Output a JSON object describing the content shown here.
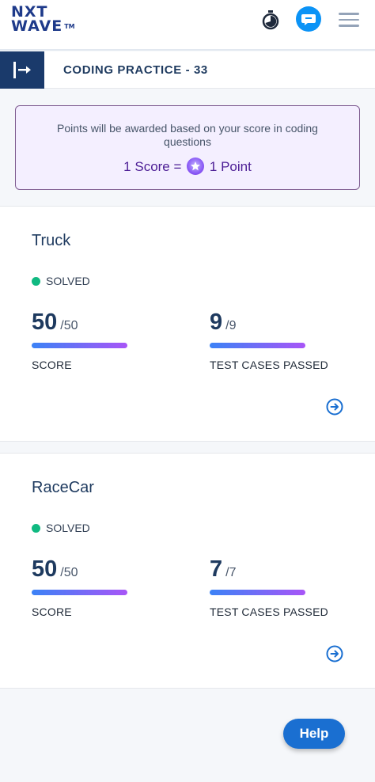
{
  "header": {
    "logo_line1": "NXT",
    "logo_line2": "WAVE",
    "logo_tm": "TM"
  },
  "subheader": {
    "title": "CODING PRACTICE - 33"
  },
  "notice": {
    "message": "Points will be awarded based on your score in coding questions",
    "rule_left": "1 Score =",
    "rule_right": "1 Point"
  },
  "problems": [
    {
      "name": "Truck",
      "status": "SOLVED",
      "score": "50",
      "score_total": "/50",
      "score_label": "SCORE",
      "tests": "9",
      "tests_total": "/9",
      "tests_label": "TEST CASES PASSED"
    },
    {
      "name": "RaceCar",
      "status": "SOLVED",
      "score": "50",
      "score_total": "/50",
      "score_label": "SCORE",
      "tests": "7",
      "tests_total": "/7",
      "tests_label": "TEST CASES PASSED"
    }
  ],
  "help_button": "Help",
  "colors": {
    "brand_navy": "#1a3a6b",
    "solved_green": "#10b981",
    "help_blue": "#1a6fd1",
    "notice_bg": "#f4efff"
  }
}
